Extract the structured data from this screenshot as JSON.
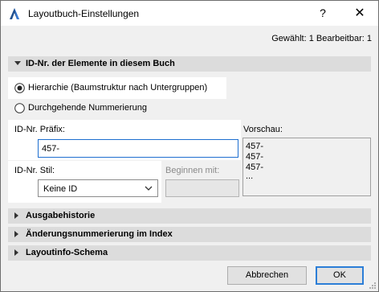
{
  "window": {
    "title": "Layoutbuch-Einstellungen",
    "help_label": "?",
    "close_label": "✕"
  },
  "selection_info": "Gewählt: 1 Bearbeitbar: 1",
  "id_section": {
    "title": "ID-Nr. der Elemente in diesem Buch",
    "radio_hierarchy": "Hierarchie (Baumstruktur nach Untergruppen)",
    "radio_continuous": "Durchgehende Nummerierung",
    "prefix_label": "ID-Nr. Präfix:",
    "prefix_value": "457-",
    "style_label": "ID-Nr. Stil:",
    "style_value": "Keine ID",
    "start_label": "Beginnen mit:",
    "start_value": "",
    "preview_label": "Vorschau:",
    "preview_lines": [
      "457-",
      "457-",
      "457-",
      "..."
    ]
  },
  "sections": {
    "output_history": "Ausgabehistorie",
    "change_numbering": "Änderungsnummerierung im Index",
    "layoutinfo": "Layoutinfo-Schema"
  },
  "buttons": {
    "cancel": "Abbrechen",
    "ok": "OK"
  },
  "colors": {
    "accent": "#2c7ed7",
    "section_bg": "#dcdcdc",
    "dialog_bg": "#f0f0f0"
  }
}
